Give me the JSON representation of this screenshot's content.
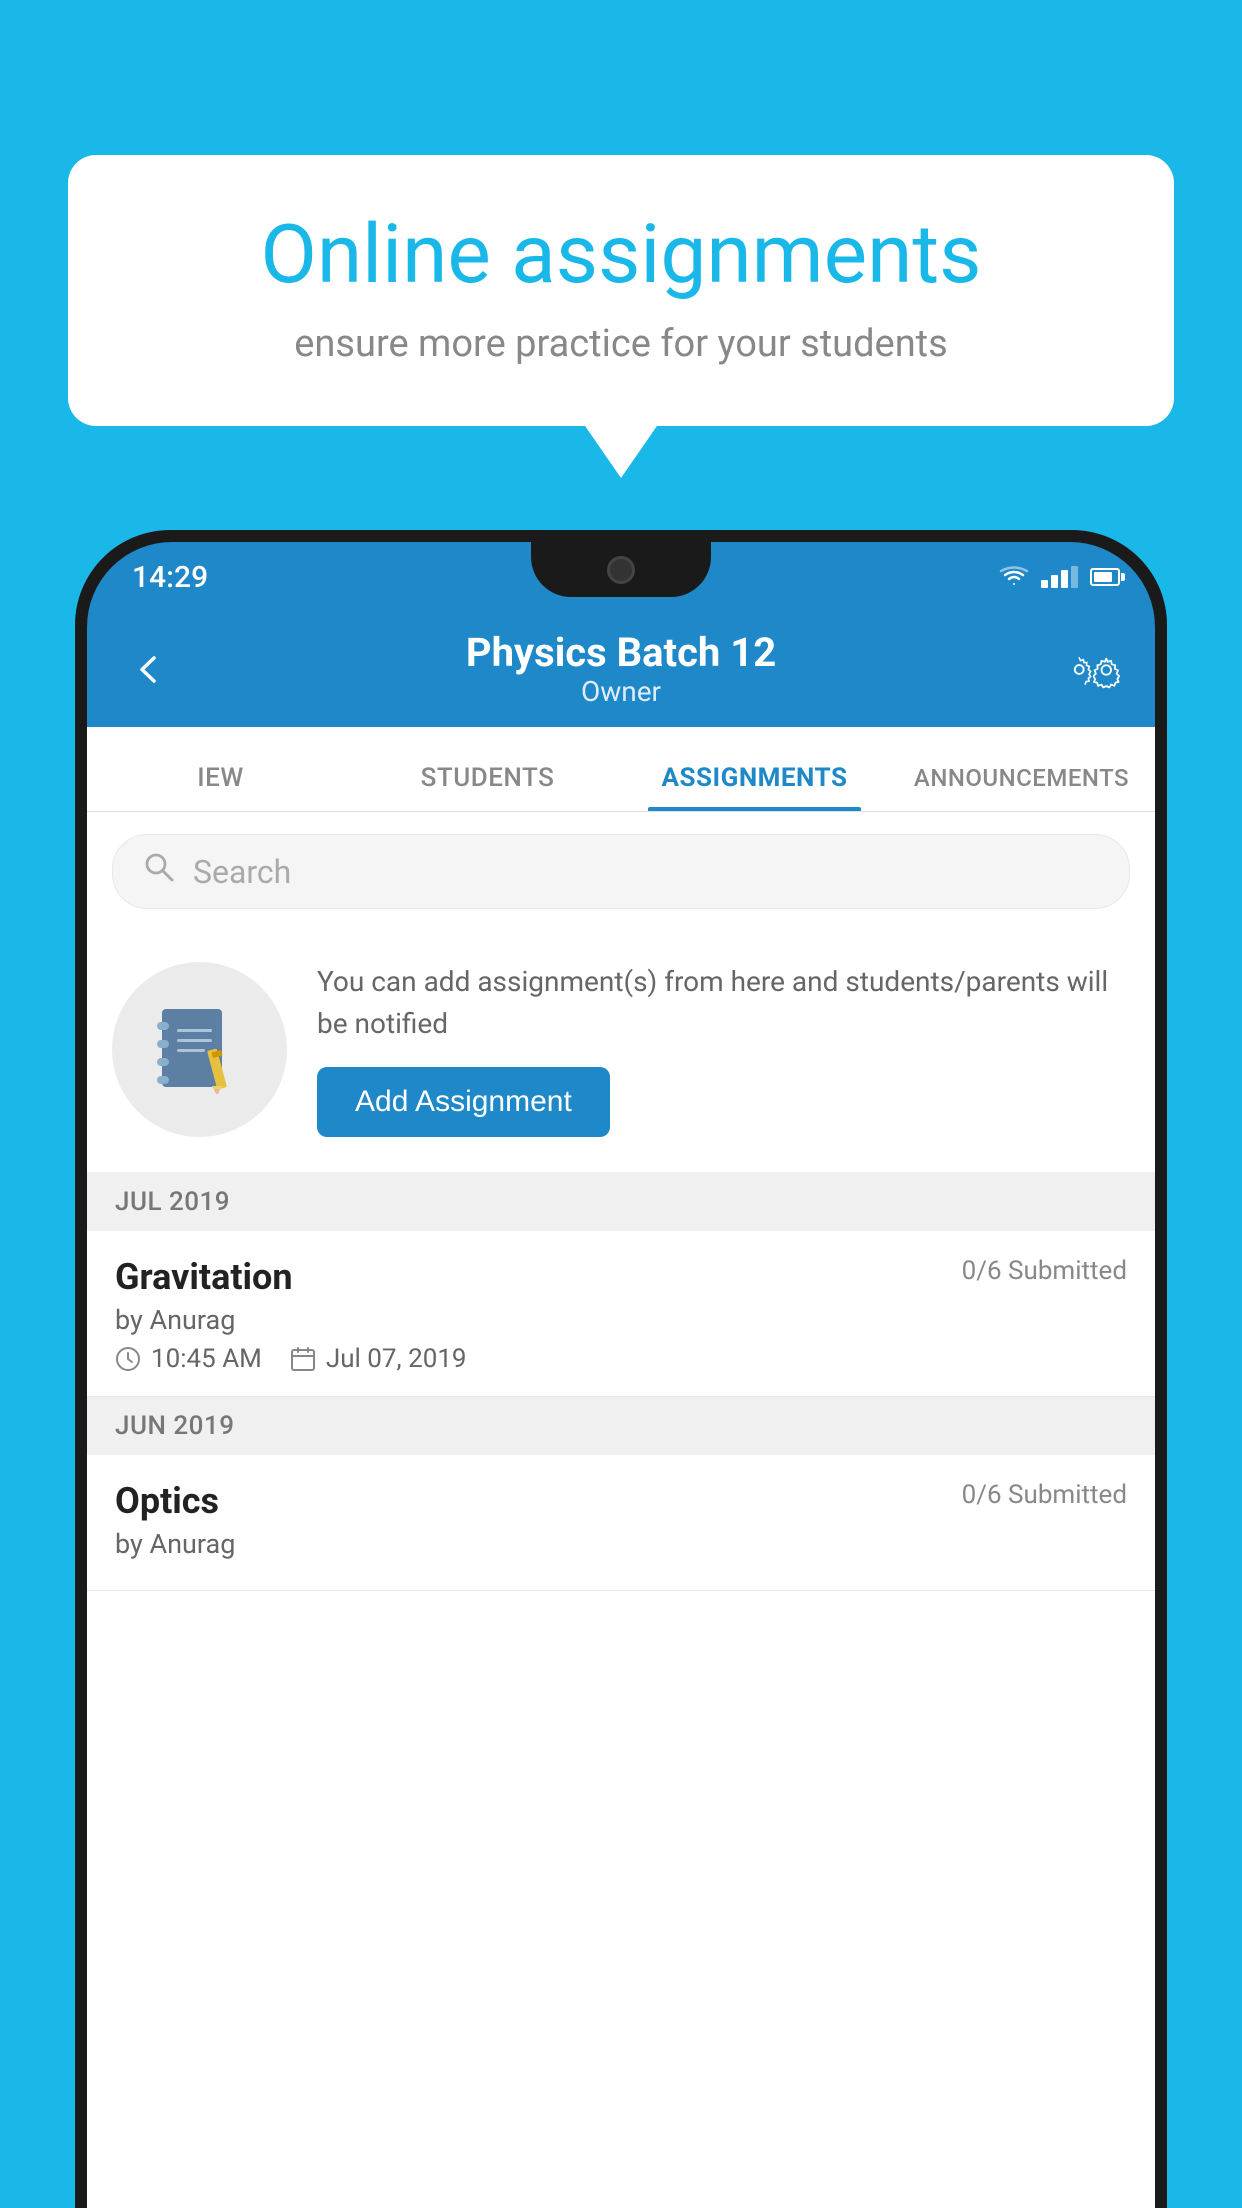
{
  "background_color": "#1ab8e8",
  "bubble": {
    "title": "Online assignments",
    "subtitle": "ensure more practice for your students"
  },
  "status_bar": {
    "time": "14:29"
  },
  "app_bar": {
    "title": "Physics Batch 12",
    "subtitle": "Owner",
    "back_label": "back",
    "settings_label": "settings"
  },
  "tabs": [
    {
      "label": "IEW",
      "active": false
    },
    {
      "label": "STUDENTS",
      "active": false
    },
    {
      "label": "ASSIGNMENTS",
      "active": true
    },
    {
      "label": "ANNOUNCEMENTS",
      "active": false
    }
  ],
  "search": {
    "placeholder": "Search"
  },
  "promo": {
    "description": "You can add assignment(s) from here and students/parents will be notified",
    "button_label": "Add Assignment"
  },
  "sections": [
    {
      "header": "JUL 2019",
      "assignments": [
        {
          "name": "Gravitation",
          "submitted": "0/6 Submitted",
          "by": "by Anurag",
          "time": "10:45 AM",
          "date": "Jul 07, 2019"
        }
      ]
    },
    {
      "header": "JUN 2019",
      "assignments": [
        {
          "name": "Optics",
          "submitted": "0/6 Submitted",
          "by": "by Anurag",
          "time": "",
          "date": ""
        }
      ]
    }
  ]
}
